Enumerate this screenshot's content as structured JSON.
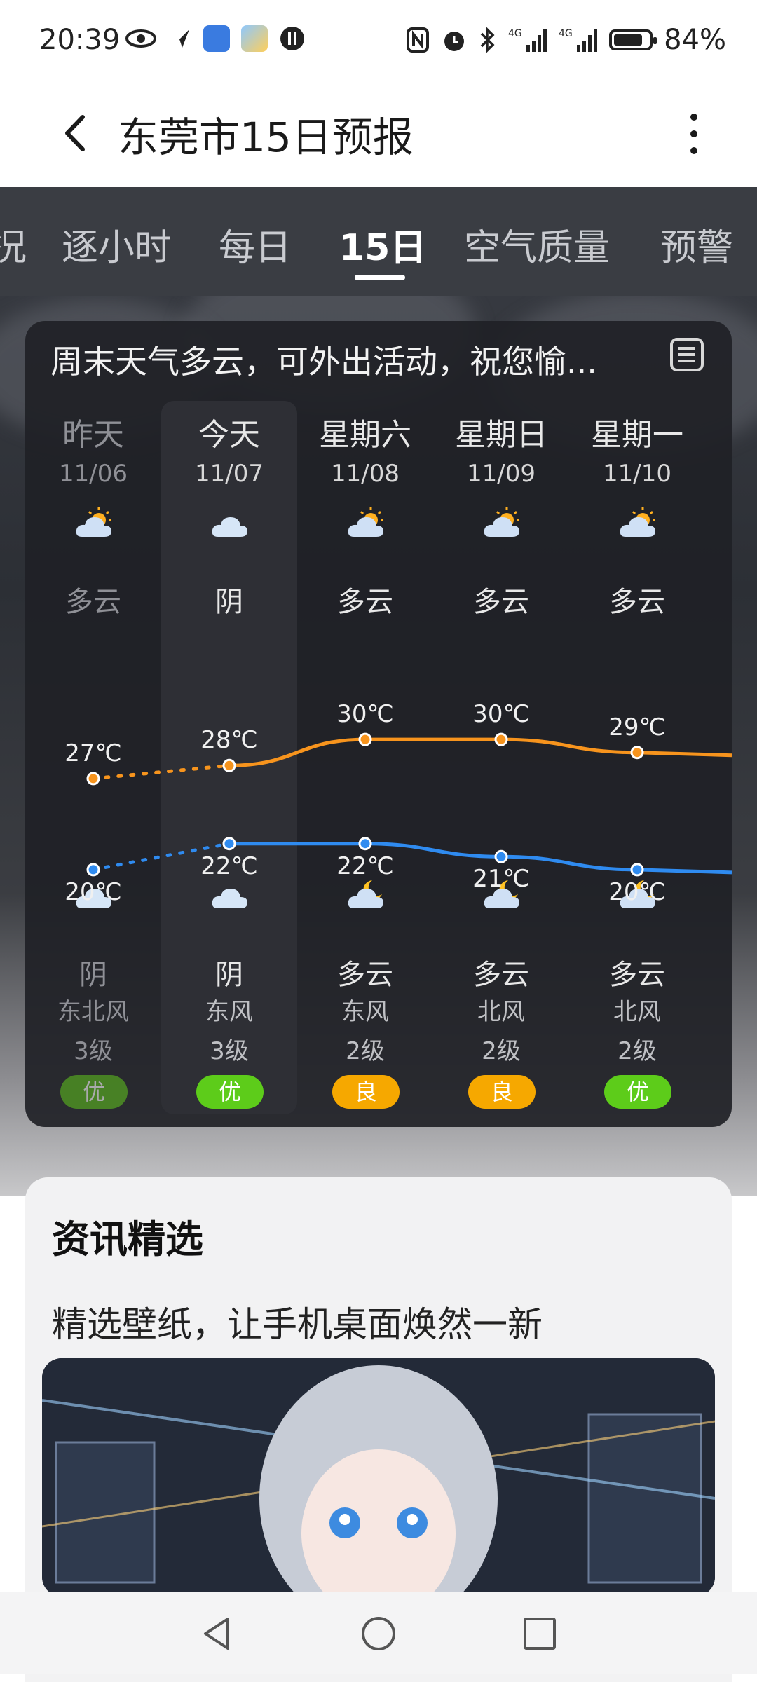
{
  "status_bar": {
    "time": "20:39",
    "battery": "84%",
    "battery_level": 0.84,
    "network": [
      "4G",
      "4G"
    ]
  },
  "header": {
    "title": "东莞市15日预报"
  },
  "tabs": [
    {
      "label": "况",
      "active": false
    },
    {
      "label": "逐小时",
      "active": false
    },
    {
      "label": "每日",
      "active": false
    },
    {
      "label": "15日",
      "active": true
    },
    {
      "label": "空气质量",
      "active": false
    },
    {
      "label": "预警",
      "active": false
    }
  ],
  "summary": "周末天气多云，可外出活动，祝您愉...",
  "days": [
    {
      "day": "昨天",
      "date": "11/06",
      "day_icon": "partly-cloudy-sun-icon",
      "cond_day": "多云",
      "high": "27℃",
      "low": "20℃",
      "night_icon": "overcast-cloud-icon",
      "cond_night": "阴",
      "wind": "东北风",
      "level": "3级",
      "aqi": "优",
      "aqi_color": "#5dbb1f"
    },
    {
      "day": "今天",
      "date": "11/07",
      "day_icon": "overcast-cloud-icon",
      "cond_day": "阴",
      "high": "28℃",
      "low": "22℃",
      "night_icon": "overcast-cloud-icon",
      "cond_night": "阴",
      "wind": "东风",
      "level": "3级",
      "aqi": "优",
      "aqi_color": "#5dcc1a"
    },
    {
      "day": "星期六",
      "date": "11/08",
      "day_icon": "partly-cloudy-sun-icon",
      "cond_day": "多云",
      "high": "30℃",
      "low": "22℃",
      "night_icon": "partly-cloudy-moon-icon",
      "cond_night": "多云",
      "wind": "东风",
      "level": "2级",
      "aqi": "良",
      "aqi_color": "#f6a800"
    },
    {
      "day": "星期日",
      "date": "11/09",
      "day_icon": "partly-cloudy-sun-icon",
      "cond_day": "多云",
      "high": "30℃",
      "low": "21℃",
      "night_icon": "partly-cloudy-moon-icon",
      "cond_night": "多云",
      "wind": "北风",
      "level": "2级",
      "aqi": "良",
      "aqi_color": "#f6a800"
    },
    {
      "day": "星期一",
      "date": "11/10",
      "day_icon": "partly-cloudy-sun-icon",
      "cond_day": "多云",
      "high": "29℃",
      "low": "20℃",
      "night_icon": "partly-cloudy-moon-icon",
      "cond_night": "多云",
      "wind": "北风",
      "level": "2级",
      "aqi": "优",
      "aqi_color": "#5dcc1a"
    }
  ],
  "chart_data": {
    "type": "line",
    "categories": [
      "11/06",
      "11/07",
      "11/08",
      "11/09",
      "11/10"
    ],
    "series": [
      {
        "values": [
          27,
          28,
          30,
          30,
          29
        ],
        "color": "#f7941d"
      },
      {
        "values": [
          20,
          22,
          22,
          21,
          20
        ],
        "color": "#2f8bf0"
      }
    ]
  },
  "news": {
    "title": "资讯精选",
    "subtitle": "精选壁纸，让手机桌面焕然一新",
    "image": "anime-girl-wallpaper"
  }
}
